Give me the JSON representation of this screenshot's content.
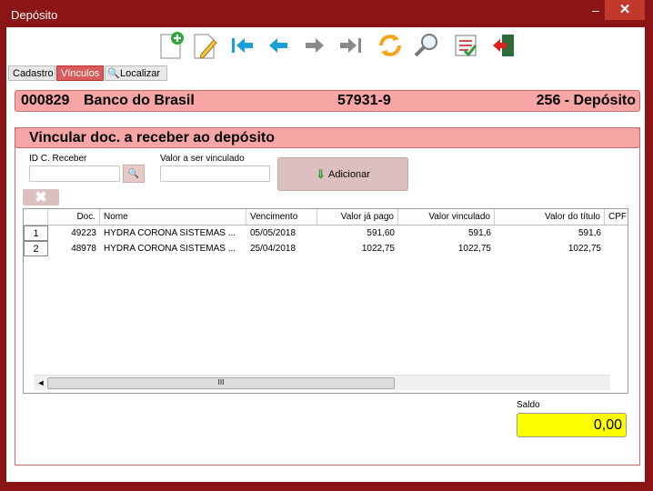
{
  "window": {
    "title": "Depósito",
    "minimize_glyph": "–",
    "close_glyph": "✕"
  },
  "toolbar": {
    "icons": [
      "new-doc-icon",
      "edit-doc-icon",
      "first-icon",
      "prev-icon",
      "next-icon",
      "last-icon",
      "refresh-icon",
      "search-icon",
      "checklist-icon",
      "exit-icon"
    ]
  },
  "tabs": [
    {
      "label": "Cadastro"
    },
    {
      "label": "Vínculos"
    },
    {
      "label": "Localizar"
    }
  ],
  "deposit_header": {
    "code": "000829",
    "bank": "Banco do Brasil",
    "account": "57931-9",
    "type": "256 - Depósito"
  },
  "section": {
    "title": "Vincular doc. a receber ao depósito",
    "id_label": "ID C. Receber",
    "id_value": "",
    "amount_label": "Valor a ser vinculado",
    "amount_value": "",
    "add_label": "Adicionar"
  },
  "grid": {
    "columns": [
      "Doc.",
      "Nome",
      "Vencimento",
      "Valor já pago",
      "Valor vinculado",
      "Valor do título",
      "CPF"
    ],
    "rows": [
      {
        "num": "1",
        "doc": "49223",
        "nome": "HYDRA CORONA SISTEMAS ...",
        "venc": "05/05/2018",
        "pago": "591,60",
        "vinc": "591,6",
        "titulo": "591,6",
        "cpf": ""
      },
      {
        "num": "2",
        "doc": "48978",
        "nome": "HYDRA CORONA SISTEMAS ...",
        "venc": "25/04/2018",
        "pago": "1022,75",
        "vinc": "1022,75",
        "titulo": "1022,75",
        "cpf": ""
      }
    ],
    "scroll_thumb_text": "III"
  },
  "saldo": {
    "label": "Saldo",
    "value": "0,00"
  },
  "colors": {
    "frame": "#8b1414",
    "header_bg": "#f8a5a5",
    "active_tab": "#d95b5b",
    "saldo_bg": "#ffff00"
  }
}
